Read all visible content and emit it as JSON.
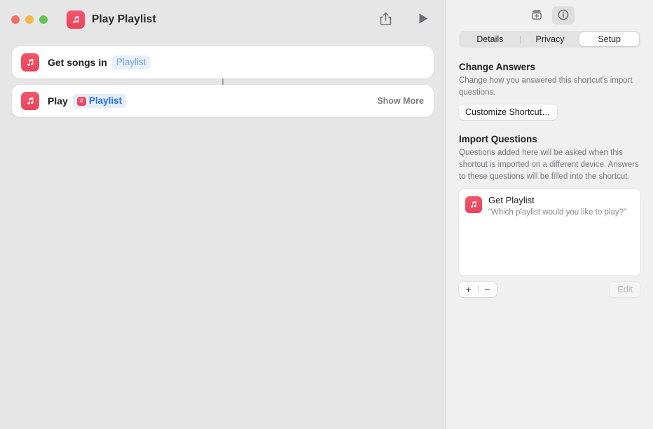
{
  "window": {
    "title": "Play Playlist",
    "app_icon": "music-note-icon",
    "traffic_lights": {
      "close": "close-button",
      "minimize": "minimize-button",
      "maximize": "maximize-button"
    },
    "colors": {
      "app_accent": "#e8455c",
      "editor_background": "#e6e6e6",
      "inspector_background": "#f0f0f0",
      "token_variable": "#2673ee",
      "token_placeholder": "#7aa7f0"
    }
  },
  "toolbar": {
    "share_icon": "share-icon",
    "run_icon": "play-icon"
  },
  "editor": {
    "actions": [
      {
        "icon": "music-note-icon",
        "label": "Get songs in",
        "token": "Playlist",
        "token_type": "placeholder",
        "token_icon": null,
        "trailing": null
      },
      {
        "icon": "music-note-icon",
        "label": "Play",
        "token": "Playlist",
        "token_type": "variable",
        "token_icon": "music-note-icon",
        "trailing": "Show More"
      }
    ]
  },
  "inspector": {
    "toolbar": [
      {
        "name": "add-to-shortcut-icon",
        "selected": false
      },
      {
        "name": "info-icon",
        "selected": true
      }
    ],
    "tabs": [
      {
        "label": "Details",
        "active": false
      },
      {
        "label": "Privacy",
        "active": false
      },
      {
        "label": "Setup",
        "active": true
      }
    ],
    "change_answers": {
      "title": "Change Answers",
      "description": "Change how you answered this shortcut's import questions.",
      "button_label": "Customize Shortcut…"
    },
    "import_questions": {
      "title": "Import Questions",
      "description": "Questions added here will be asked when this shortcut is imported on a different device. Answers to these questions will be filled into the shortcut.",
      "items": [
        {
          "icon": "music-note-icon",
          "title": "Get Playlist",
          "prompt": "“Which playlist would you like to play?”"
        }
      ],
      "add_label": "+",
      "remove_label": "−",
      "edit_label": "Edit"
    }
  }
}
